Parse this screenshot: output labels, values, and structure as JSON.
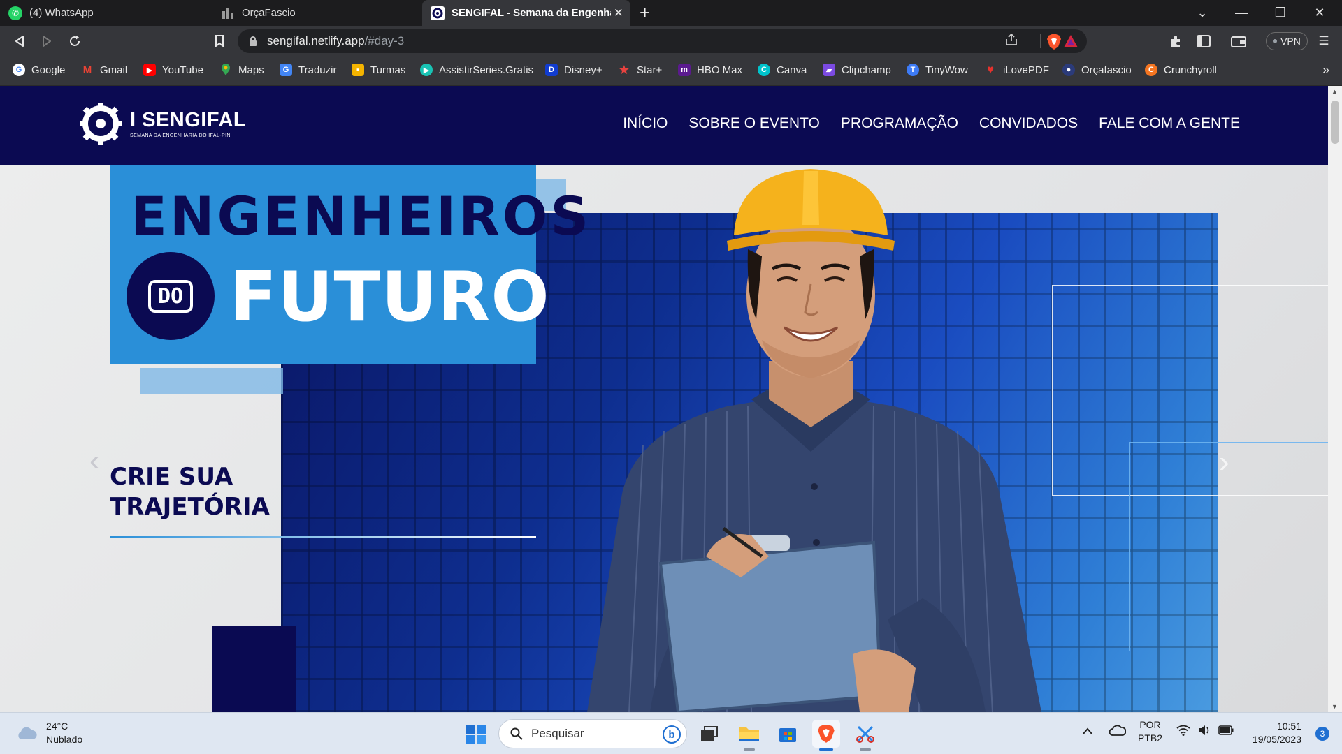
{
  "browser": {
    "tabs": [
      {
        "title": "(4) WhatsApp",
        "icon": "whatsapp-icon",
        "color": "#25d366",
        "active": false
      },
      {
        "title": "OrçaFascio",
        "icon": "orcafascio-icon",
        "color": "#8a8a8a",
        "active": false
      },
      {
        "title": "SENGIFAL - Semana da Engenhari",
        "icon": "sengifal-icon",
        "color": "#ffffff",
        "active": true
      }
    ],
    "url_host": "sengifal.netlify.app",
    "url_path": "/#day-3",
    "vpn_label": "VPN",
    "bookmarks": [
      {
        "label": "Google",
        "icon": "google-icon",
        "color": "#ea4335"
      },
      {
        "label": "Gmail",
        "icon": "gmail-icon",
        "color": "#d93025"
      },
      {
        "label": "YouTube",
        "icon": "youtube-icon",
        "color": "#ff0000"
      },
      {
        "label": "Maps",
        "icon": "maps-icon",
        "color": "#34a853"
      },
      {
        "label": "Traduzir",
        "icon": "translate-icon",
        "color": "#4285f4"
      },
      {
        "label": "Turmas",
        "icon": "classroom-icon",
        "color": "#f4b400"
      },
      {
        "label": "AssistirSeries.Gratis",
        "icon": "assistirseries-icon",
        "color": "#19c3b4"
      },
      {
        "label": "Disney+",
        "icon": "disney-icon",
        "color": "#113ccf"
      },
      {
        "label": "Star+",
        "icon": "star-icon",
        "color": "#e8423f"
      },
      {
        "label": "HBO Max",
        "icon": "hbomax-icon",
        "color": "#5b1a8f"
      },
      {
        "label": "Canva",
        "icon": "canva-icon",
        "color": "#00c4cc"
      },
      {
        "label": "Clipchamp",
        "icon": "clipchamp-icon",
        "color": "#7b4ae2"
      },
      {
        "label": "TinyWow",
        "icon": "tinywow-icon",
        "color": "#3d7bf6"
      },
      {
        "label": "iLovePDF",
        "icon": "ilovepdf-icon",
        "color": "#e5322d"
      },
      {
        "label": "Orçafascio",
        "icon": "orcafascio-icon",
        "color": "#2b3b7a"
      },
      {
        "label": "Crunchyroll",
        "icon": "crunchyroll-icon",
        "color": "#f47521"
      }
    ]
  },
  "site": {
    "logo_name": "I SENGIFAL",
    "logo_sub": "SEMANA DA ENGENHARIA DO IFAL-PIN",
    "nav": [
      "INÍCIO",
      "SOBRE O EVENTO",
      "PROGRAMAÇÃO",
      "CONVIDADOS",
      "FALE COM A GENTE"
    ],
    "hero": {
      "line1": "ENGENHEIROS",
      "circle_text": "DO",
      "line3": "FUTURO",
      "tagline_1": "CRIE SUA",
      "tagline_2": "TRAJETÓRIA"
    },
    "colors": {
      "navy": "#0b0a52",
      "blue": "#2a8fd8"
    }
  },
  "taskbar": {
    "weather_temp": "24°C",
    "weather_desc": "Nublado",
    "search_placeholder": "Pesquisar",
    "lang_1": "POR",
    "lang_2": "PTB2",
    "time": "10:51",
    "date": "19/05/2023",
    "notifications": "3"
  }
}
